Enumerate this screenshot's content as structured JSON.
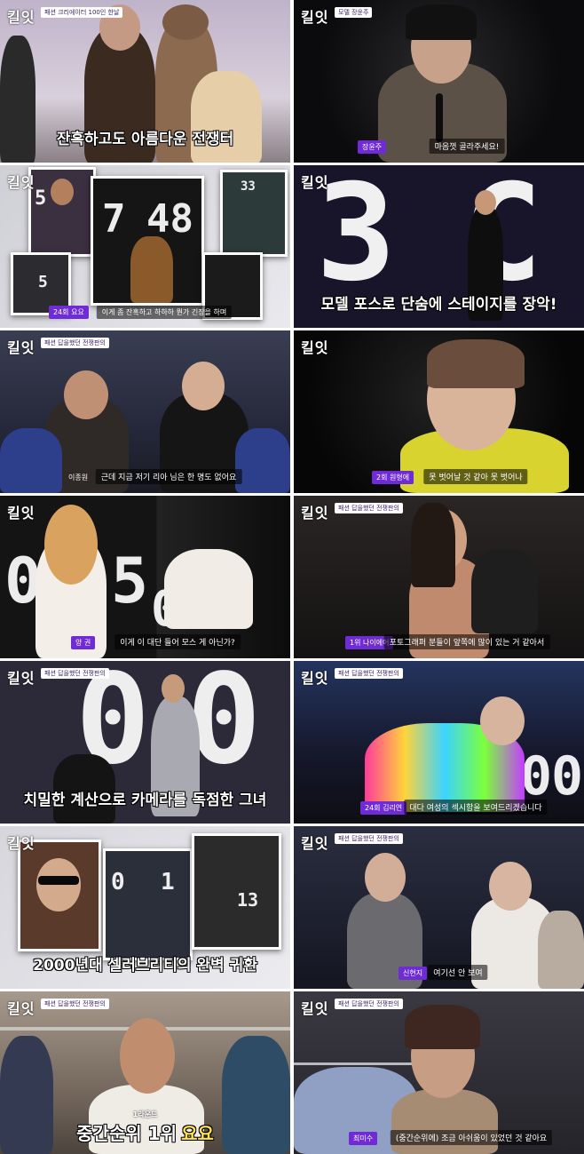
{
  "logo": "킬잇",
  "panels": [
    {
      "tag": "패션 크리에이터 100인 한날",
      "subtitle": "잔혹하고도 아름다운 전쟁터"
    },
    {
      "tag": "모델 장윤주",
      "speaker": "장윤주",
      "caption": "마음껏 골라주세요!"
    },
    {
      "tag": "",
      "speaker": "24회 요요",
      "caption": "이게 좀 잔혹하고 하하하 뭔가 긴장을 하며",
      "digits": [
        "7",
        "48"
      ],
      "small_digits": [
        "5",
        "33",
        "5"
      ]
    },
    {
      "tag": "",
      "subtitle": "모델 포스로 단숨에 스테이지를 장악!",
      "digits": [
        "3",
        "C"
      ]
    },
    {
      "tag": "패션 답을했던 전쟁판의",
      "speaker": "이종원",
      "caption": "근데 지금 저기 리아 님은 한 명도 없어요"
    },
    {
      "tag": "",
      "speaker": "2회 원형에",
      "caption": "못 벗어날 것 같아 못 벗어나"
    },
    {
      "tag": "",
      "speaker": "양 권",
      "caption": "이게 이 대단 들어 모스 게 아닌가?",
      "digits": [
        "0",
        "5",
        "0"
      ]
    },
    {
      "tag": "패션 답을했던 전쟁판의",
      "speaker": "1위 나이에어",
      "caption": "포토그래퍼 분들이 앞쪽에 많이 있는 거 같아서"
    },
    {
      "tag": "패션 답을했던 전쟁판의",
      "subtitle": "치밀한 계산으로 카메라를 독점한 그녀",
      "digits": [
        "0",
        "0"
      ]
    },
    {
      "tag": "패션 답을했던 전쟁판의",
      "speaker": "24회 김리연",
      "caption": "대다 여성의 섹시함을 보여드리겠습니다",
      "digits": [
        "0",
        "0"
      ]
    },
    {
      "tag": "",
      "subtitle": "2000년대 셀러브리티의 완벽 귀환",
      "small_digits": [
        "0",
        "1",
        "13"
      ]
    },
    {
      "tag": "패션 답을했던 전쟁판의",
      "speaker": "신현지",
      "caption": "여기선 안 보여"
    },
    {
      "tag": "패션 답을했던 전쟁판의",
      "rank_small": "1라운드",
      "rank_big": "중간순위 1위",
      "rank_name": "요요"
    },
    {
      "tag": "패션 답을했던 전쟁판의",
      "speaker": "최미수",
      "caption": "(중간순위에) 조금 아쉬움이 있었던 것 같아요"
    }
  ],
  "colors": {
    "accent": "#6f2bd6",
    "highlight": "#ffe34d",
    "dark": "#1a1a1f"
  }
}
